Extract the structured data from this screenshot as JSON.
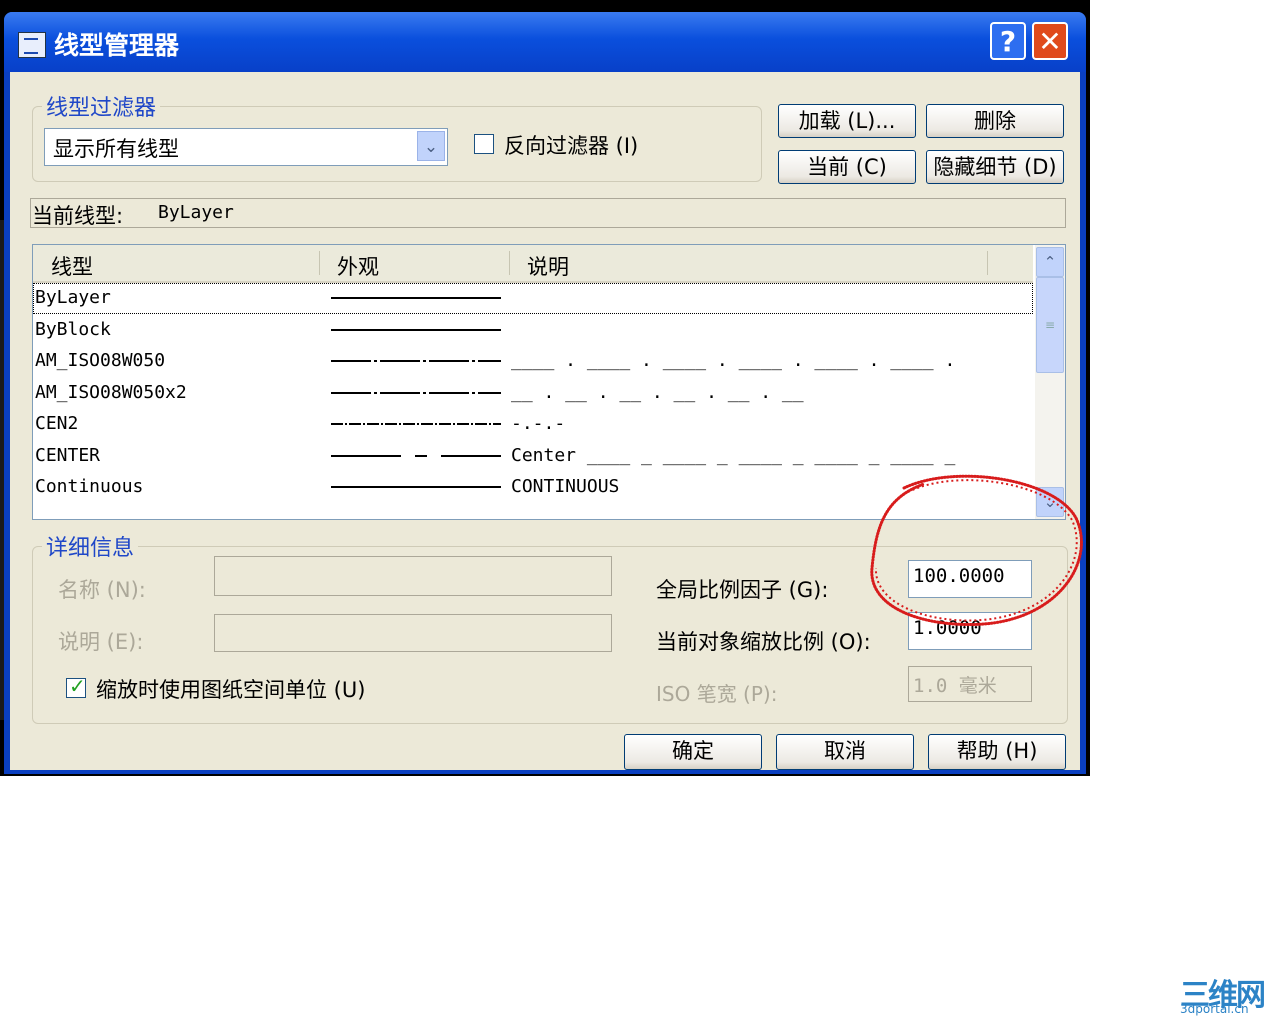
{
  "dialog": {
    "title": "线型管理器",
    "help_glyph": "?",
    "close_glyph": "✕"
  },
  "filter": {
    "legend": "线型过滤器",
    "selected": "显示所有线型",
    "dropdown_glyph": "⌄",
    "invert_label": "反向过滤器 (I)",
    "invert_checked": false
  },
  "buttons": {
    "load": "加载 (L)...",
    "delete": "删除",
    "current": "当前 (C)",
    "hide_details": "隐藏细节 (D)",
    "ok": "确定",
    "cancel": "取消",
    "help": "帮助 (H)"
  },
  "current_linetype": {
    "label": "当前线型:",
    "value": "ByLayer"
  },
  "list": {
    "columns": [
      "线型",
      "外观",
      "说明"
    ],
    "rows": [
      {
        "name": "ByLayer",
        "description": "",
        "pattern": "solid",
        "selected": true
      },
      {
        "name": "ByBlock",
        "description": "",
        "pattern": "solid",
        "selected": false
      },
      {
        "name": "AM_ISO08W050",
        "description": "____ . ____ . ____ . ____ . ____ . ____ .",
        "pattern": "dashdot",
        "selected": false
      },
      {
        "name": "AM_ISO08W050x2",
        "description": "__ . __ . __ . __ . __ . __",
        "pattern": "dashdot",
        "selected": false
      },
      {
        "name": "CEN2",
        "description": "-.-.-",
        "pattern": "cen2",
        "selected": false
      },
      {
        "name": "CENTER",
        "description": "Center ____ _ ____ _ ____ _ ____ _ ____ _",
        "pattern": "center",
        "selected": false
      },
      {
        "name": "Continuous",
        "description": "CONTINUOUS",
        "pattern": "solid",
        "selected": false
      }
    ],
    "scroll_up_glyph": "⌃",
    "scroll_down_glyph": "⌄"
  },
  "details": {
    "legend": "详细信息",
    "name_label": "名称 (N):",
    "name_value": "",
    "desc_label": "说明 (E):",
    "desc_value": "",
    "paper_units_label": "缩放时使用图纸空间单位 (U)",
    "paper_units_checked": true,
    "global_scale_label": "全局比例因子 (G):",
    "global_scale_value": "100.0000",
    "object_scale_label": "当前对象缩放比例 (O):",
    "object_scale_value": "1.0000",
    "iso_pen_label": "ISO 笔宽 (P):",
    "iso_pen_value": "1.0 毫米"
  },
  "watermark": {
    "text": "三维网",
    "sub": "3dportal.cn"
  },
  "colors": {
    "title_blue": "#0a4fdd",
    "face": "#ece9d8",
    "annotation_red": "#d81c1c",
    "legend_blue": "#1f47c8"
  }
}
